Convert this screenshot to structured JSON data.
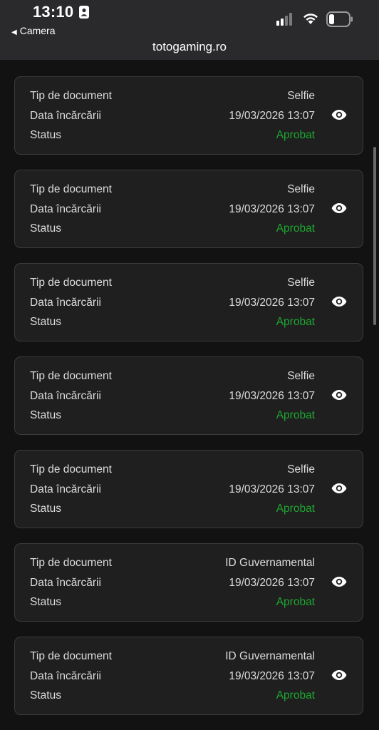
{
  "status_bar": {
    "time": "13:10",
    "back_app": "Camera",
    "battery_icon": "battery-icon",
    "wifi_icon": "wifi-icon",
    "signal_icon": "signal-icon"
  },
  "browser": {
    "url": "totogaming.ro"
  },
  "colors": {
    "approved": "#1ea631",
    "card_bg": "#1f1f1f",
    "page_bg": "#121212"
  },
  "documents": [
    {
      "type_label": "Tip de document",
      "type_value": "Selfie",
      "date_label": "Data încărcării",
      "date_value": "19/03/2026 13:07",
      "status_label": "Status",
      "status_value": "Aprobat",
      "icon": "eye-icon"
    },
    {
      "type_label": "Tip de document",
      "type_value": "Selfie",
      "date_label": "Data încărcării",
      "date_value": "19/03/2026 13:07",
      "status_label": "Status",
      "status_value": "Aprobat",
      "icon": "eye-icon"
    },
    {
      "type_label": "Tip de document",
      "type_value": "Selfie",
      "date_label": "Data încărcării",
      "date_value": "19/03/2026 13:07",
      "status_label": "Status",
      "status_value": "Aprobat",
      "icon": "eye-icon"
    },
    {
      "type_label": "Tip de document",
      "type_value": "Selfie",
      "date_label": "Data încărcării",
      "date_value": "19/03/2026 13:07",
      "status_label": "Status",
      "status_value": "Aprobat",
      "icon": "eye-icon"
    },
    {
      "type_label": "Tip de document",
      "type_value": "Selfie",
      "date_label": "Data încărcării",
      "date_value": "19/03/2026 13:07",
      "status_label": "Status",
      "status_value": "Aprobat",
      "icon": "eye-icon"
    },
    {
      "type_label": "Tip de document",
      "type_value": "ID Guvernamental",
      "date_label": "Data încărcării",
      "date_value": "19/03/2026 13:07",
      "status_label": "Status",
      "status_value": "Aprobat",
      "icon": "eye-icon"
    },
    {
      "type_label": "Tip de document",
      "type_value": "ID Guvernamental",
      "date_label": "Data încărcării",
      "date_value": "19/03/2026 13:07",
      "status_label": "Status",
      "status_value": "Aprobat",
      "icon": "eye-icon"
    }
  ]
}
